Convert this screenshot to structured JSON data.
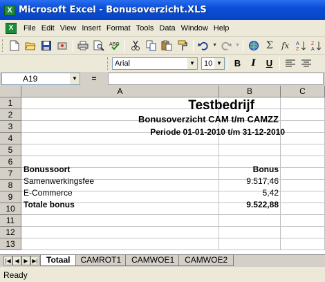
{
  "window": {
    "title": "Microsoft Excel - Bonusoverzicht.XLS",
    "app_icon": "excel-logo-icon"
  },
  "menu": [
    "File",
    "Edit",
    "View",
    "Insert",
    "Format",
    "Tools",
    "Data",
    "Window",
    "Help"
  ],
  "toolbar": {
    "icons": [
      "new-icon",
      "open-icon",
      "save-icon",
      "permission-icon",
      "print-icon",
      "print-preview-icon",
      "spelling-icon",
      "cut-icon",
      "copy-icon",
      "paste-icon",
      "format-painter-icon",
      "undo-icon",
      "redo-icon",
      "hyperlink-icon",
      "autosum-icon",
      "function-icon",
      "sort-ascending-icon",
      "sort-descending-icon"
    ],
    "font": "Arial",
    "size": "10",
    "bold_label": "B",
    "italic_label": "I",
    "underline_label": "U"
  },
  "formula_bar": {
    "name_box": "A19",
    "equals": "=",
    "formula": ""
  },
  "grid": {
    "columns": [
      "A",
      "B",
      "C"
    ],
    "row_numbers": [
      "1",
      "2",
      "3",
      "4",
      "5",
      "6",
      "7",
      "8",
      "9",
      "10",
      "11",
      "12",
      "13"
    ],
    "cells": {
      "r1": "Testbedrijf",
      "r2": "Bonusoverzicht CAM t/m CAMZZ",
      "r3": "Periode 01-01-2010 t/m 31-12-2010",
      "r6a": "Bonussoort",
      "r6b": "Bonus",
      "r7a": "Samenwerkingsfee",
      "r7b": "9.517,46",
      "r8a": "E-Commerce",
      "r8b": "5,42",
      "r9a": "Totale bonus",
      "r9b": "9.522,88"
    }
  },
  "sheet_tabs": [
    "Totaal",
    "CAMROT1",
    "CAMWOE1",
    "CAMWOE2"
  ],
  "active_tab": "Totaal",
  "status": "Ready"
}
